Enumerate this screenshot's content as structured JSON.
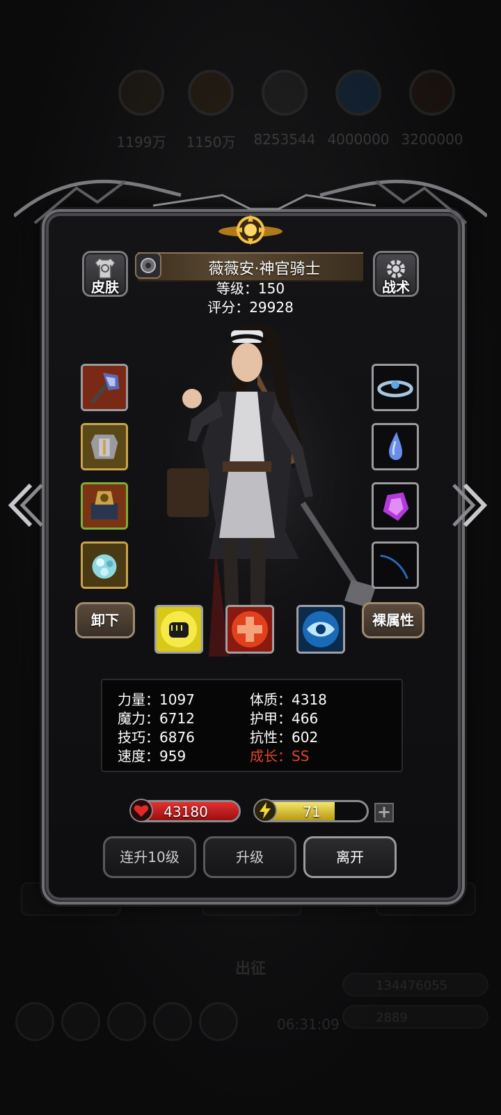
{
  "background": {
    "resources": [
      "1199万",
      "1150万",
      "8253544",
      "4000000",
      "3200000"
    ],
    "tabs": [
      "",
      "",
      ""
    ],
    "section_title": "出征",
    "timer": "06:31:09",
    "gold": "134476055",
    "gems": "2889"
  },
  "top_buttons": {
    "skin_label": "皮肤",
    "tactics_label": "战术"
  },
  "hero": {
    "name": "薇薇安·神官骑士",
    "level_label": "等级",
    "level_value": "150",
    "score_label": "评分",
    "score_value": "29928",
    "separator": "："
  },
  "equipment": {
    "left": [
      "weapon-mace",
      "armor-chest",
      "tome-relic",
      "ring-crystal"
    ],
    "right": [
      "tiara-blue",
      "gem-water",
      "gem-purple",
      "empty-blue-swirl"
    ]
  },
  "actions": {
    "unequip_label": "卸下",
    "base_stats_label": "裸属性",
    "skills": [
      "fist-skill-icon",
      "heal-cross-skill-icon",
      "eye-skill-icon"
    ]
  },
  "stats": {
    "strength_label": "力量",
    "strength": "1097",
    "magic_label": "魔力",
    "magic": "6712",
    "skill_label": "技巧",
    "skill": "6876",
    "speed_label": "速度",
    "speed": "959",
    "constitution_label": "体质",
    "constitution": "4318",
    "armor_label": "护甲",
    "armor": "466",
    "resistance_label": "抗性",
    "resistance": "602",
    "growth_label": "成长",
    "growth": "SS"
  },
  "bars": {
    "hp_value": "43180",
    "hp_fill_percent": 100,
    "energy_value": "71",
    "energy_fill_percent": 71,
    "plus_label": "+"
  },
  "bottom_buttons": {
    "level_up_10_label": "连升10级",
    "level_up_label": "升级",
    "leave_label": "离开"
  },
  "colors": {
    "growth_red": "#e1442a",
    "hp_red": "#d82424",
    "energy_yellow": "#e8d443"
  }
}
